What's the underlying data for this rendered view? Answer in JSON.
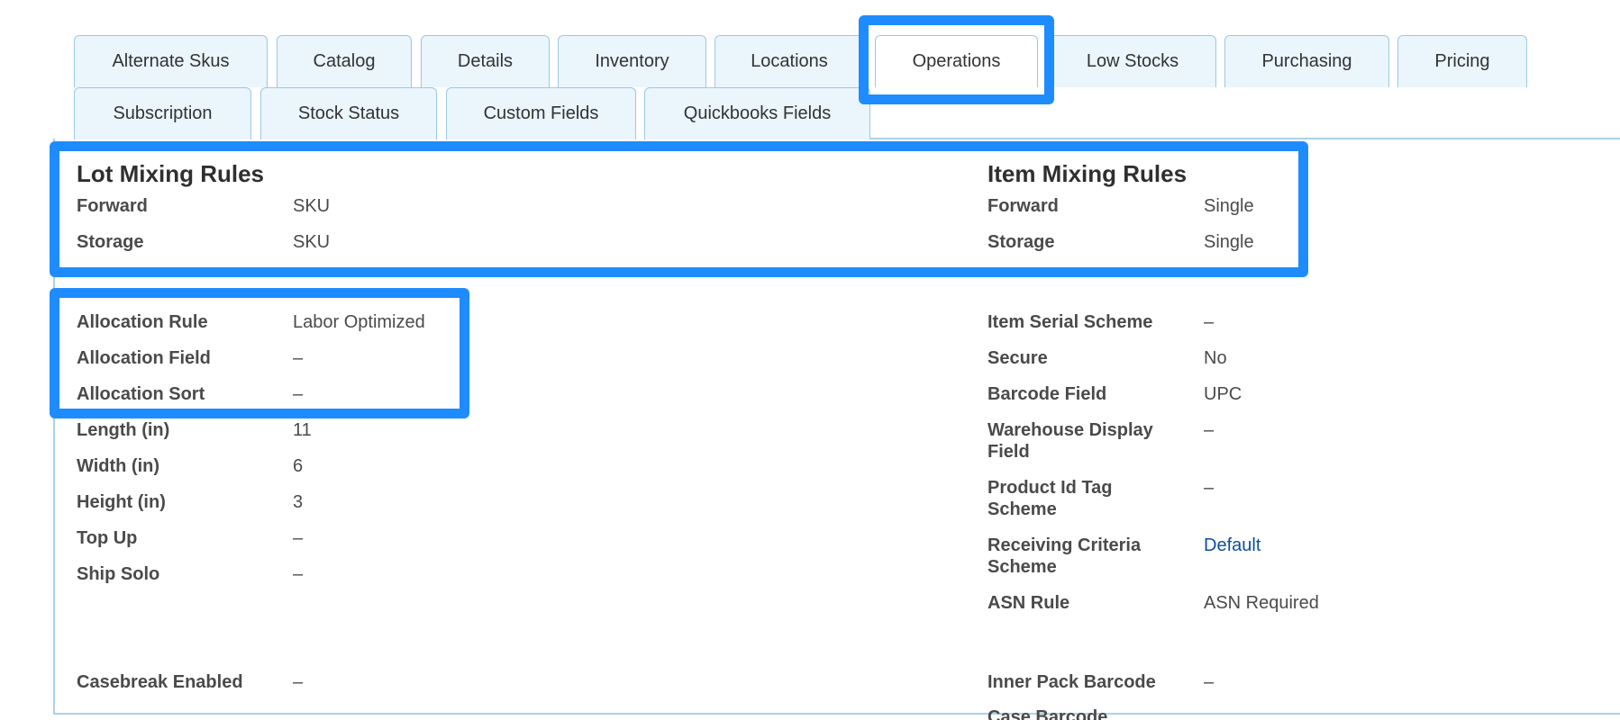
{
  "tabs": {
    "row1": [
      {
        "label": "Alternate Skus"
      },
      {
        "label": "Catalog"
      },
      {
        "label": "Details"
      },
      {
        "label": "Inventory"
      },
      {
        "label": "Locations"
      },
      {
        "label": "Operations",
        "active": true
      },
      {
        "label": "Low Stocks"
      },
      {
        "label": "Purchasing"
      },
      {
        "label": "Pricing"
      }
    ],
    "row2": [
      {
        "label": "Subscription"
      },
      {
        "label": "Stock Status"
      },
      {
        "label": "Custom Fields"
      },
      {
        "label": "Quickbooks Fields"
      }
    ]
  },
  "lot_mixing": {
    "title": "Lot Mixing Rules",
    "rows": [
      {
        "label": "Forward",
        "value": "SKU"
      },
      {
        "label": "Storage",
        "value": "SKU"
      }
    ]
  },
  "item_mixing": {
    "title": "Item Mixing Rules",
    "rows": [
      {
        "label": "Forward",
        "value": "Single"
      },
      {
        "label": "Storage",
        "value": "Single"
      }
    ]
  },
  "left_fields": {
    "allocation_rule": {
      "label": "Allocation Rule",
      "value": "Labor Optimized"
    },
    "allocation_field": {
      "label": "Allocation Field",
      "value": "–"
    },
    "allocation_sort": {
      "label": "Allocation Sort",
      "value": "–"
    },
    "length": {
      "label": "Length (in)",
      "value": "11"
    },
    "width": {
      "label": "Width (in)",
      "value": "6"
    },
    "height": {
      "label": "Height (in)",
      "value": "3"
    },
    "top_up": {
      "label": "Top Up",
      "value": "–"
    },
    "ship_solo": {
      "label": "Ship Solo",
      "value": "–"
    },
    "casebreak_enabled": {
      "label": "Casebreak Enabled",
      "value": "–"
    }
  },
  "right_fields": {
    "item_serial_scheme": {
      "label": "Item Serial Scheme",
      "value": "–"
    },
    "secure": {
      "label": "Secure",
      "value": "No"
    },
    "barcode_field": {
      "label": "Barcode Field",
      "value": "UPC"
    },
    "warehouse_display_field": {
      "label": "Warehouse Display Field",
      "value": "–"
    },
    "product_id_tag_scheme": {
      "label": "Product Id Tag Scheme",
      "value": "–"
    },
    "receiving_criteria_scheme": {
      "label": "Receiving Criteria Scheme",
      "value": "Default"
    },
    "asn_rule": {
      "label": "ASN Rule",
      "value": "ASN Required"
    },
    "inner_pack_barcode": {
      "label": "Inner Pack Barcode",
      "value": "–"
    },
    "case_barcode": {
      "label": "Case Barcode"
    }
  },
  "colors": {
    "highlight": "#1e8cff",
    "tab_bg": "#eaf5fc",
    "tab_border": "#9cc9e3",
    "link": "#0a4ea3"
  }
}
